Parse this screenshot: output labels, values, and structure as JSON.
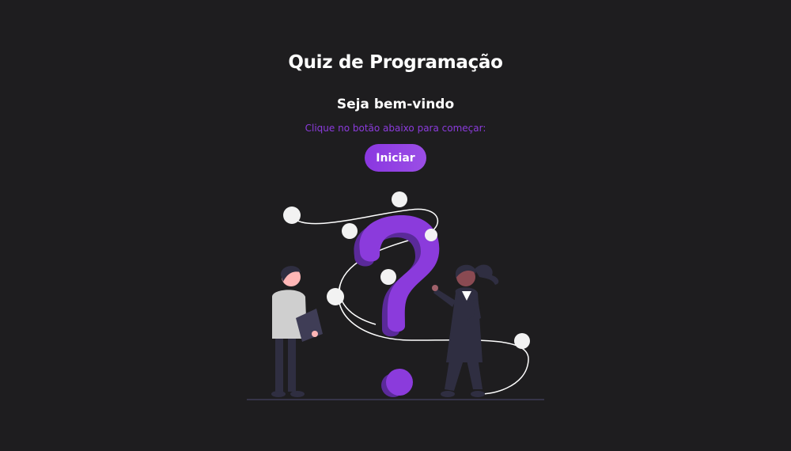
{
  "quiz": {
    "title": "Quiz de Programação",
    "welcome": "Seja bem-vindo",
    "instruction": "Clique no botão abaixo para começar:",
    "start_label": "Iniciar"
  },
  "illustration": {
    "icon": "question-mark-people-illustration"
  },
  "colors": {
    "background": "#1e1d1f",
    "accent": "#8b3bdc",
    "text": "#ffffff"
  }
}
